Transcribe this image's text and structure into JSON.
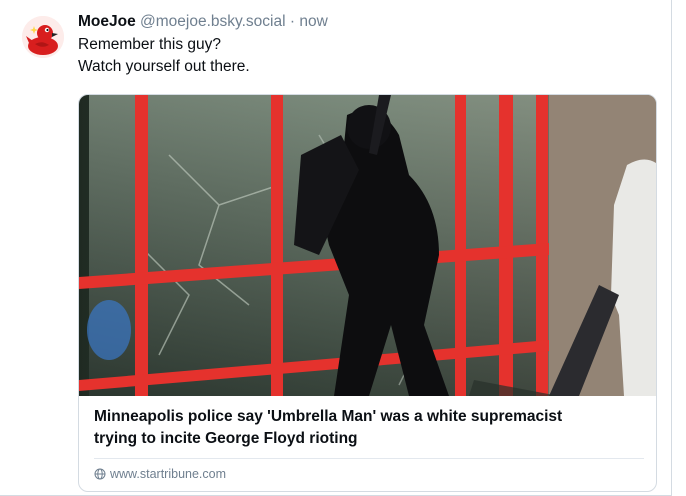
{
  "post": {
    "display_name": "MoeJoe",
    "handle": "@moejoe.bsky.social",
    "separator": "·",
    "time": "now",
    "text_lines": [
      "Remember this guy?",
      "Watch yourself out there."
    ],
    "avatar_icon": "red-rubber-duck-icon"
  },
  "embed": {
    "title_lines": [
      "Minneapolis police say 'Umbrella Man' was a white supremacist",
      "trying to incite George Floyd rioting"
    ],
    "domain": "www.startribune.com",
    "domain_icon": "globe-icon",
    "image_subject": "person in black smashing a red-framed store window"
  },
  "colors": {
    "text": "#0b0f14",
    "muted": "#6f7f8f",
    "border": "#d4dbe2",
    "window_frame": "#e5322d"
  }
}
